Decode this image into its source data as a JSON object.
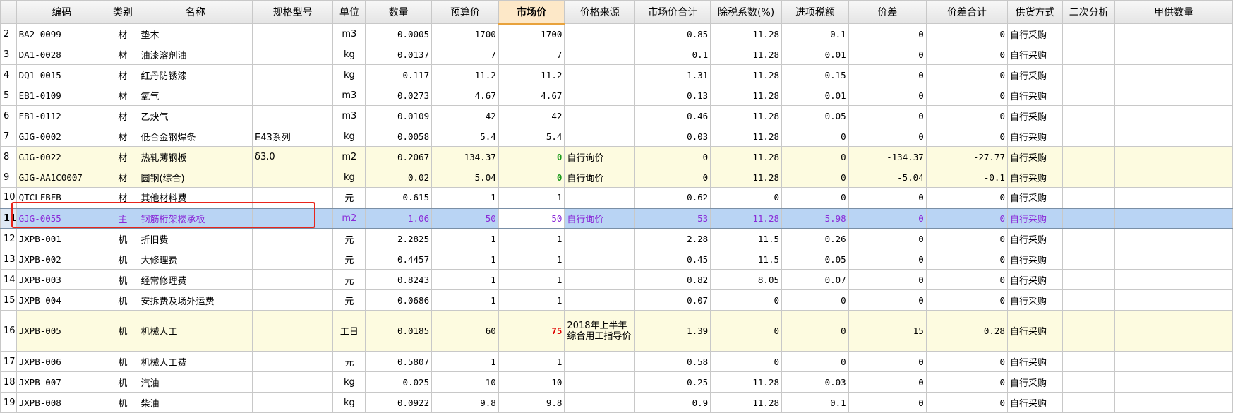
{
  "columns": [
    "编码",
    "类别",
    "名称",
    "规格型号",
    "单位",
    "数量",
    "预算价",
    "市场价",
    "价格来源",
    "市场价合计",
    "除税系数(%)",
    "进项税额",
    "价差",
    "价差合计",
    "供货方式",
    "二次分析",
    "甲供数量"
  ],
  "rows": [
    {
      "n": "2",
      "code": "BA2-0099",
      "cat": "材",
      "name": "垫木",
      "spec": "",
      "unit": "m3",
      "qty": "0.0005",
      "budget": "1700",
      "market": "1700",
      "src": "",
      "mtotal": "0.85",
      "taxcoef": "11.28",
      "inputtax": "0.1",
      "diff": "0",
      "difftotal": "0",
      "supply": "自行采购",
      "second": "",
      "jia": ""
    },
    {
      "n": "3",
      "code": "DA1-0028",
      "cat": "材",
      "name": "油漆溶剂油",
      "spec": "",
      "unit": "kg",
      "qty": "0.0137",
      "budget": "7",
      "market": "7",
      "src": "",
      "mtotal": "0.1",
      "taxcoef": "11.28",
      "inputtax": "0.01",
      "diff": "0",
      "difftotal": "0",
      "supply": "自行采购",
      "second": "",
      "jia": ""
    },
    {
      "n": "4",
      "code": "DQ1-0015",
      "cat": "材",
      "name": "红丹防锈漆",
      "spec": "",
      "unit": "kg",
      "qty": "0.117",
      "budget": "11.2",
      "market": "11.2",
      "src": "",
      "mtotal": "1.31",
      "taxcoef": "11.28",
      "inputtax": "0.15",
      "diff": "0",
      "difftotal": "0",
      "supply": "自行采购",
      "second": "",
      "jia": ""
    },
    {
      "n": "5",
      "code": "EB1-0109",
      "cat": "材",
      "name": "氧气",
      "spec": "",
      "unit": "m3",
      "qty": "0.0273",
      "budget": "4.67",
      "market": "4.67",
      "src": "",
      "mtotal": "0.13",
      "taxcoef": "11.28",
      "inputtax": "0.01",
      "diff": "0",
      "difftotal": "0",
      "supply": "自行采购",
      "second": "",
      "jia": ""
    },
    {
      "n": "6",
      "code": "EB1-0112",
      "cat": "材",
      "name": "乙炔气",
      "spec": "",
      "unit": "m3",
      "qty": "0.0109",
      "budget": "42",
      "market": "42",
      "src": "",
      "mtotal": "0.46",
      "taxcoef": "11.28",
      "inputtax": "0.05",
      "diff": "0",
      "difftotal": "0",
      "supply": "自行采购",
      "second": "",
      "jia": ""
    },
    {
      "n": "7",
      "code": "GJG-0002",
      "cat": "材",
      "name": "低合金钢焊条",
      "spec": "E43系列",
      "unit": "kg",
      "qty": "0.0058",
      "budget": "5.4",
      "market": "5.4",
      "src": "",
      "mtotal": "0.03",
      "taxcoef": "11.28",
      "inputtax": "0",
      "diff": "0",
      "difftotal": "0",
      "supply": "自行采购",
      "second": "",
      "jia": ""
    },
    {
      "n": "8",
      "code": "GJG-0022",
      "cat": "材",
      "name": "热轧薄钢板",
      "spec": "δ3.0",
      "unit": "m2",
      "qty": "0.2067",
      "budget": "134.37",
      "market": "0",
      "src": "自行询价",
      "mtotal": "0",
      "taxcoef": "11.28",
      "inputtax": "0",
      "diff": "-134.37",
      "difftotal": "-27.77",
      "supply": "自行采购",
      "second": "",
      "jia": ""
    },
    {
      "n": "9",
      "code": "GJG-AA1C0007",
      "cat": "材",
      "name": "圆钢(综合)",
      "spec": "",
      "unit": "kg",
      "qty": "0.02",
      "budget": "5.04",
      "market": "0",
      "src": "自行询价",
      "mtotal": "0",
      "taxcoef": "11.28",
      "inputtax": "0",
      "diff": "-5.04",
      "difftotal": "-0.1",
      "supply": "自行采购",
      "second": "",
      "jia": ""
    },
    {
      "n": "10",
      "code": "QTCLFBFB",
      "cat": "材",
      "name": "其他材料费",
      "spec": "",
      "unit": "元",
      "qty": "0.615",
      "budget": "1",
      "market": "1",
      "src": "",
      "mtotal": "0.62",
      "taxcoef": "0",
      "inputtax": "0",
      "diff": "0",
      "difftotal": "0",
      "supply": "自行采购",
      "second": "",
      "jia": ""
    },
    {
      "n": "11",
      "code": "GJG-0055",
      "cat": "主",
      "name": "钢筋桁架楼承板",
      "spec": "",
      "unit": "m2",
      "qty": "1.06",
      "budget": "50",
      "market": "50",
      "src": "自行询价",
      "mtotal": "53",
      "taxcoef": "11.28",
      "inputtax": "5.98",
      "diff": "0",
      "difftotal": "0",
      "supply": "自行采购",
      "second": "",
      "jia": ""
    },
    {
      "n": "12",
      "code": "JXPB-001",
      "cat": "机",
      "name": "折旧费",
      "spec": "",
      "unit": "元",
      "qty": "2.2825",
      "budget": "1",
      "market": "1",
      "src": "",
      "mtotal": "2.28",
      "taxcoef": "11.5",
      "inputtax": "0.26",
      "diff": "0",
      "difftotal": "0",
      "supply": "自行采购",
      "second": "",
      "jia": ""
    },
    {
      "n": "13",
      "code": "JXPB-002",
      "cat": "机",
      "name": "大修理费",
      "spec": "",
      "unit": "元",
      "qty": "0.4457",
      "budget": "1",
      "market": "1",
      "src": "",
      "mtotal": "0.45",
      "taxcoef": "11.5",
      "inputtax": "0.05",
      "diff": "0",
      "difftotal": "0",
      "supply": "自行采购",
      "second": "",
      "jia": ""
    },
    {
      "n": "14",
      "code": "JXPB-003",
      "cat": "机",
      "name": "经常修理费",
      "spec": "",
      "unit": "元",
      "qty": "0.8243",
      "budget": "1",
      "market": "1",
      "src": "",
      "mtotal": "0.82",
      "taxcoef": "8.05",
      "inputtax": "0.07",
      "diff": "0",
      "difftotal": "0",
      "supply": "自行采购",
      "second": "",
      "jia": ""
    },
    {
      "n": "15",
      "code": "JXPB-004",
      "cat": "机",
      "name": "安拆费及场外运费",
      "spec": "",
      "unit": "元",
      "qty": "0.0686",
      "budget": "1",
      "market": "1",
      "src": "",
      "mtotal": "0.07",
      "taxcoef": "0",
      "inputtax": "0",
      "diff": "0",
      "difftotal": "0",
      "supply": "自行采购",
      "second": "",
      "jia": ""
    },
    {
      "n": "16",
      "code": "JXPB-005",
      "cat": "机",
      "name": "机械人工",
      "spec": "",
      "unit": "工日",
      "qty": "0.0185",
      "budget": "60",
      "market": "75",
      "src": "2018年上半年综合用工指导价",
      "mtotal": "1.39",
      "taxcoef": "0",
      "inputtax": "0",
      "diff": "15",
      "difftotal": "0.28",
      "supply": "自行采购",
      "second": "",
      "jia": ""
    },
    {
      "n": "17",
      "code": "JXPB-006",
      "cat": "机",
      "name": "机械人工费",
      "spec": "",
      "unit": "元",
      "qty": "0.5807",
      "budget": "1",
      "market": "1",
      "src": "",
      "mtotal": "0.58",
      "taxcoef": "0",
      "inputtax": "0",
      "diff": "0",
      "difftotal": "0",
      "supply": "自行采购",
      "second": "",
      "jia": ""
    },
    {
      "n": "18",
      "code": "JXPB-007",
      "cat": "机",
      "name": "汽油",
      "spec": "",
      "unit": "kg",
      "qty": "0.025",
      "budget": "10",
      "market": "10",
      "src": "",
      "mtotal": "0.25",
      "taxcoef": "11.28",
      "inputtax": "0.03",
      "diff": "0",
      "difftotal": "0",
      "supply": "自行采购",
      "second": "",
      "jia": ""
    },
    {
      "n": "19",
      "code": "JXPB-008",
      "cat": "机",
      "name": "柴油",
      "spec": "",
      "unit": "kg",
      "qty": "0.0922",
      "budget": "9.8",
      "market": "9.8",
      "src": "",
      "mtotal": "0.9",
      "taxcoef": "11.28",
      "inputtax": "0.1",
      "diff": "0",
      "difftotal": "0",
      "supply": "自行采购",
      "second": "",
      "jia": ""
    }
  ],
  "colors": {
    "selected_row": "#b9d4f4",
    "modified_row": "#fdfbe0",
    "changed_price_green": "#1a9a1a",
    "changed_price_red": "#e00000",
    "highlight_box": "#e8251b"
  }
}
